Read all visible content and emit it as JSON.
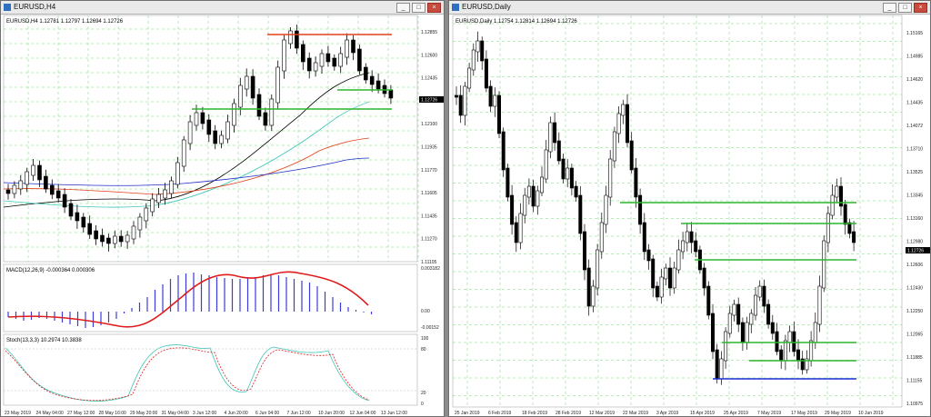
{
  "left_window": {
    "title": "EURUSD,H4",
    "main_label": "EURUSD,H4 1.12781 1.12797 1.12694 1.12726",
    "macd_label": "MACD(12,26,9) -0.000364 0.000306",
    "stoch_label": "Stoch(13,3,3) 10.2974 10.3838",
    "price_axis": [
      "1.12855",
      "1.12600",
      "1.12435",
      "1.12265",
      "1.12100",
      "1.11935",
      "1.11770",
      "1.11605",
      "1.11435",
      "1.11270",
      "1.11105"
    ],
    "current_price": "1.12726",
    "macd_axis": [
      "0.003182",
      "0.00",
      "-0.00152"
    ],
    "stoch_axis": [
      "100",
      "80",
      "20",
      "0"
    ],
    "time_axis": [
      "23 May 2019",
      "24 May 04:00",
      "27 May 12:00",
      "28 May 16:00",
      "29 May 20:00",
      "31 May 04:00",
      "3 Jun 12:00",
      "4 Jun 20:00",
      "6 Jun 04:00",
      "7 Jun 12:00",
      "10 Jun 20:00",
      "12 Jun 04:00",
      "13 Jun 12:00"
    ]
  },
  "right_window": {
    "title": "EURUSD,Daily",
    "main_label": "EURUSD,Daily 1.12754 1.12814 1.12694 1.12726",
    "price_axis": [
      "1.15165",
      "1.14985",
      "1.14620",
      "1.14435",
      "1.14072",
      "1.13710",
      "1.13525",
      "1.13345",
      "1.13160",
      "1.12980",
      "1.12606",
      "1.12430",
      "1.12250",
      "1.12065",
      "1.11885",
      "1.11155",
      "1.10975"
    ],
    "current_price": "1.12726",
    "time_axis": [
      "25 Jan 2019",
      "6 Feb 2019",
      "18 Feb 2019",
      "28 Feb 2019",
      "12 Mar 2019",
      "22 Mar 2019",
      "3 Apr 2019",
      "15 Apr 2019",
      "25 Apr 2019",
      "7 May 2019",
      "17 May 2019",
      "29 May 2019",
      "10 Jun 2019"
    ]
  },
  "colors": {
    "up_candle": "#ffffff",
    "down_candle": "#000000",
    "level_green": "#2db52d",
    "level_red": "#e0401b",
    "level_blue": "#1b2fd6",
    "macd_hist": "#3b3bd9",
    "macd_signal": "#e01b1b",
    "grid": "#7ed07e"
  }
}
